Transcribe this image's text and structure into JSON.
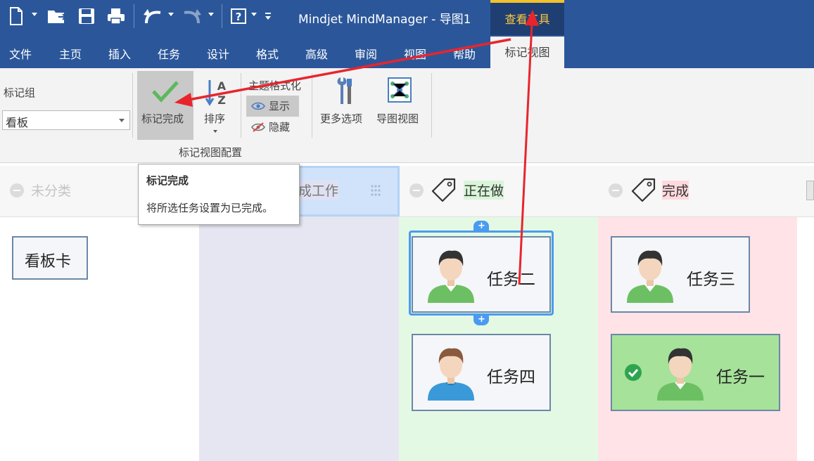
{
  "title_bar": {
    "app_title": "Mindjet MindManager - 导图1",
    "context_tab": "查看工具"
  },
  "menu": {
    "tabs": [
      "文件",
      "主页",
      "插入",
      "任务",
      "设计",
      "格式",
      "高级",
      "审阅",
      "视图",
      "帮助",
      "标记视图"
    ]
  },
  "ribbon": {
    "marker_group_label": "标记组",
    "marker_group_value": "看板",
    "mark_complete": "标记完成",
    "sort": "排序",
    "topic_format": "主题格式化",
    "show": "显示",
    "hide": "隐藏",
    "more_options": "更多选项",
    "map_view": "导图视图",
    "group_caption": "标记视图配置"
  },
  "tooltip": {
    "title": "标记完成",
    "body": "将所选任务设置为已完成。"
  },
  "board": {
    "columns": [
      {
        "label": "未分类",
        "bg": "#ffffff"
      },
      {
        "label": "成工作",
        "bg": "#e6e6f2"
      },
      {
        "label": "正在做",
        "bg": "#e4f9e4"
      },
      {
        "label": "完成",
        "bg": "#ffe3e6"
      }
    ],
    "cards": {
      "kanban": "看板卡",
      "task2": "任务二",
      "task4": "任务四",
      "task3": "任务三",
      "task1": "任务一"
    }
  },
  "colors": {
    "accent": "#2b579a",
    "context": "#ffc83d",
    "arrow": "#e8252d",
    "done_green": "#2ea44f"
  }
}
